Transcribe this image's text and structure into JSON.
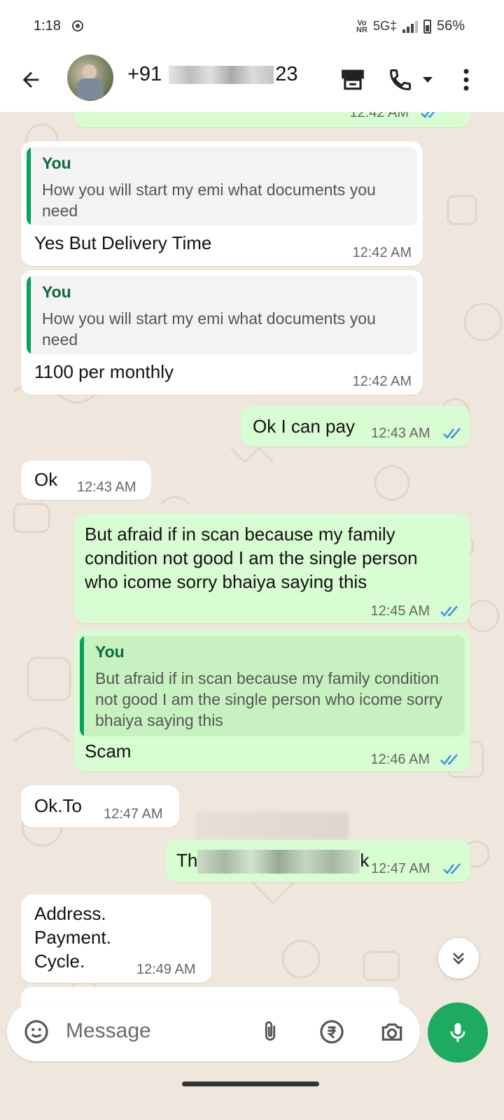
{
  "status_bar": {
    "time": "1:18",
    "volte_top": "Vo",
    "volte_bottom": "NR",
    "network": "5G‡",
    "battery": "56%"
  },
  "header": {
    "contact_prefix": "+91",
    "contact_suffix": "23"
  },
  "messages": [
    {
      "dir": "out",
      "text": "",
      "time": "12:42 AM"
    },
    {
      "dir": "in",
      "quote_author": "You",
      "quote_text": "How you will start my emi what documents you need",
      "text": "Yes But Delivery Time",
      "time": "12:42 AM"
    },
    {
      "dir": "in",
      "quote_author": "You",
      "quote_text": "How you will start my emi what documents you need",
      "text": "1100 per monthly",
      "time": "12:42 AM"
    },
    {
      "dir": "out",
      "text": "Ok I can pay",
      "time": "12:43 AM"
    },
    {
      "dir": "in",
      "text": "Ok",
      "time": "12:43 AM"
    },
    {
      "dir": "out",
      "lines": [
        "But  afraid if in scan because my family",
        "condition not good I am the single person",
        "who icome sorry bhaiya saying this"
      ],
      "time": "12:45 AM"
    },
    {
      "dir": "out",
      "quote_author": "You",
      "quote_text": "But  afraid if in scan because my family condition not good I am the single person who icome sorry bhaiya saying this",
      "text": "Scam",
      "time": "12:46 AM"
    },
    {
      "dir": "in",
      "text": "Ok.To",
      "time": "12:47 AM"
    },
    {
      "dir": "out",
      "text_start": "Th",
      "text_end": "k",
      "time": "12:47 AM"
    },
    {
      "dir": "in",
      "lines": [
        "Address.",
        "Payment.",
        "Cycle."
      ],
      "time": "12:49 AM"
    }
  ],
  "input": {
    "placeholder": "Message"
  },
  "colors": {
    "outgoing_bubble": "#d8fdd2",
    "incoming_bubble": "#ffffff",
    "accent_green": "#1daa61",
    "read_ticks": "#3a8ee6",
    "wallpaper": "#efe7de"
  },
  "icons": [
    "back-arrow-icon",
    "storefront-icon",
    "phone-icon",
    "dropdown-caret-icon",
    "more-vert-icon",
    "double-chevron-down-icon",
    "sticker-icon",
    "attach-icon",
    "rupee-icon",
    "camera-icon",
    "mic-icon"
  ]
}
